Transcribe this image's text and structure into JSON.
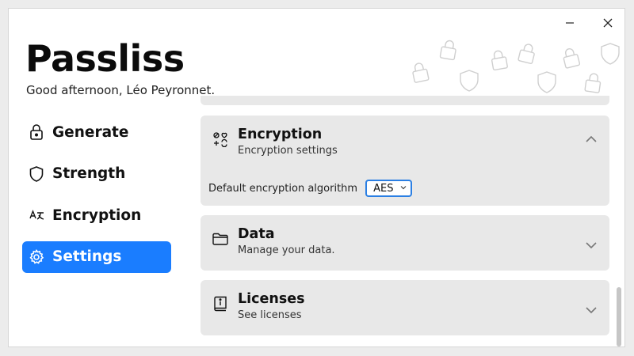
{
  "app": {
    "title": "Passliss",
    "greeting": "Good afternoon, Léo Peyronnet."
  },
  "window_controls": {
    "minimize_icon": "minimize-icon",
    "close_icon": "close-icon"
  },
  "nav": {
    "items": [
      {
        "label": "Generate",
        "icon": "lock-icon",
        "active": false
      },
      {
        "label": "Strength",
        "icon": "shield-icon",
        "active": false
      },
      {
        "label": "Encryption",
        "icon": "translate-icon",
        "active": false
      },
      {
        "label": "Settings",
        "icon": "gear-icon",
        "active": true
      }
    ]
  },
  "settings": {
    "encryption": {
      "title": "Encryption",
      "subtitle": "Encryption settings",
      "expanded": true,
      "icon": "symbols-icon",
      "algorithm_label": "Default encryption algorithm",
      "algorithm_value": "AES"
    },
    "data": {
      "title": "Data",
      "subtitle": "Manage your data.",
      "expanded": false,
      "icon": "folder-icon"
    },
    "licenses": {
      "title": "Licenses",
      "subtitle": "See licenses",
      "expanded": false,
      "icon": "license-icon"
    }
  },
  "colors": {
    "accent": "#1a7dff",
    "card_bg": "#e8e8e8",
    "select_border": "#2b7fe3"
  }
}
